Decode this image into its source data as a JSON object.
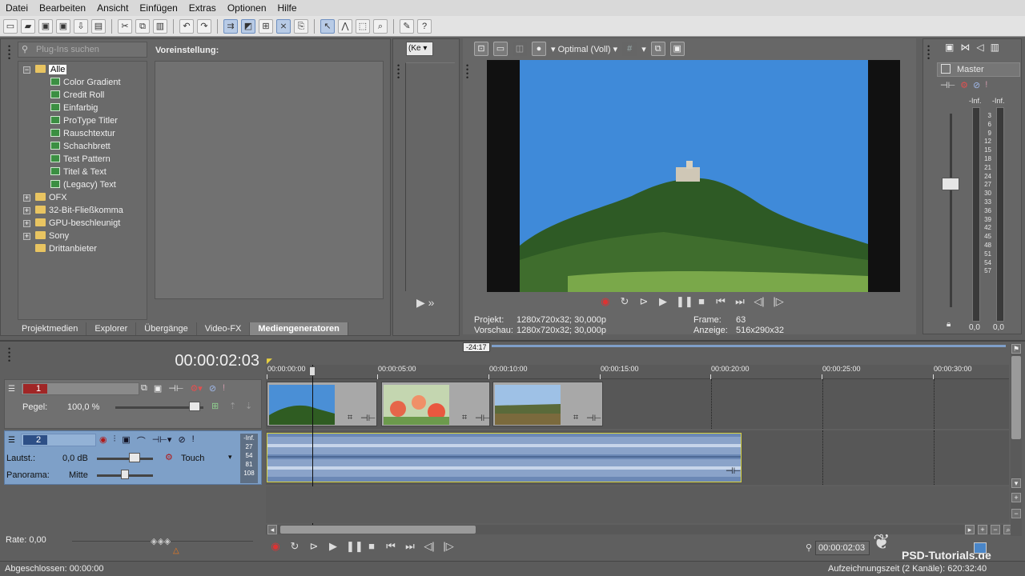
{
  "menu": [
    "Datei",
    "Bearbeiten",
    "Ansicht",
    "Einfügen",
    "Extras",
    "Optionen",
    "Hilfe"
  ],
  "plugins": {
    "search_placeholder": "Plug-Ins suchen",
    "root": "Alle",
    "items": [
      "Color Gradient",
      "Credit Roll",
      "Einfarbig",
      "ProType Titler",
      "Rauschtextur",
      "Schachbrett",
      "Test Pattern",
      "Titel & Text",
      "(Legacy) Text"
    ],
    "folders": [
      "OFX",
      "32-Bit-Fließkomma",
      "GPU-beschleunigt",
      "Sony",
      "Drittanbieter"
    ],
    "preset_label": "Voreinstellung:"
  },
  "tabs": [
    "Projektmedien",
    "Explorer",
    "Übergänge",
    "Video-FX",
    "Mediengeneratoren"
  ],
  "preview": {
    "quality": "Optimal (Voll)",
    "trimmer_select": "(Ke",
    "projekt_label": "Projekt:",
    "projekt": "1280x720x32; 30,000p",
    "vorschau_label": "Vorschau:",
    "vorschau": "1280x720x32; 30,000p",
    "frame_label": "Frame:",
    "frame": "63",
    "anzeige_label": "Anzeige:",
    "anzeige": "516x290x32"
  },
  "mixer": {
    "title": "Master",
    "inf_left": "-Inf.",
    "inf_right": "-Inf.",
    "scale": [
      "3",
      "6",
      "9",
      "12",
      "15",
      "18",
      "21",
      "24",
      "27",
      "30",
      "33",
      "36",
      "39",
      "42",
      "45",
      "48",
      "51",
      "54",
      "57"
    ],
    "val_left": "0,0",
    "val_right": "0,0"
  },
  "timeline": {
    "timecode": "00:00:02:03",
    "marker": "-24:17",
    "ruler": [
      "00:00:00:00",
      "00:00:05:00",
      "00:00:10:00",
      "00:00:15:00",
      "00:00:20:00",
      "00:00:25:00",
      "00:00:30:00"
    ],
    "track1": {
      "number": "1",
      "pegel_label": "Pegel:",
      "pegel": "100,0 %"
    },
    "track2": {
      "number": "2",
      "lautst_label": "Lautst.:",
      "lautst": "0,0 dB",
      "mode": "Touch",
      "pan_label": "Panorama:",
      "pan": "Mitte",
      "meter": [
        "-Inf.",
        "27",
        "54",
        "81",
        "108"
      ]
    },
    "rate": "Rate: 0,00",
    "cursor_time": "00:00:02:03"
  },
  "status": {
    "left": "Abgeschlossen: 00:00:00",
    "right": "Aufzeichnungszeit (2 Kanäle): 620:32:40",
    "watermark": "PSD-Tutorials.de"
  }
}
